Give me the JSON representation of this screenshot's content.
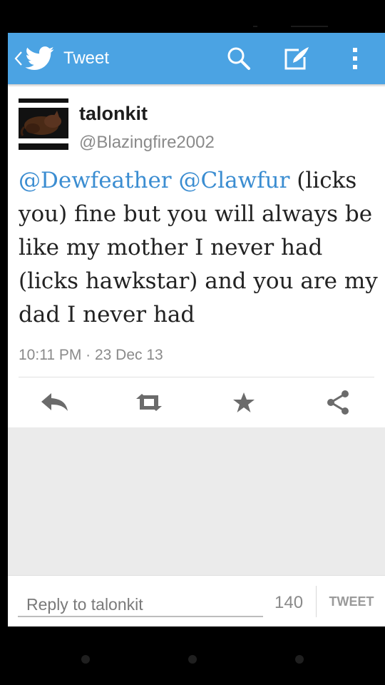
{
  "actionbar": {
    "title": "Tweet",
    "back_icon": "chevron-left-icon",
    "logo_icon": "twitter-bird-icon",
    "icons": [
      "search-icon",
      "compose-icon",
      "overflow-menu-icon"
    ],
    "color": "#4ba3e3"
  },
  "tweet": {
    "author_name": "talonkit",
    "author_handle": "@Blazingfire2002",
    "mention_1": "@Dewfeather",
    "mention_2": "@Clawfur",
    "body": "(licks you) fine but you will always be like my mother I never had (licks hawkstar) and you are my dad I never had",
    "timestamp": "10:11 PM · 23 Dec 13",
    "mention_color": "#3b8dd1"
  },
  "actions": [
    "reply-icon",
    "retweet-icon",
    "favorite-star-icon",
    "share-icon"
  ],
  "reply": {
    "placeholder": "Reply to talonkit",
    "char_count": "140",
    "button_label": "TWEET"
  }
}
